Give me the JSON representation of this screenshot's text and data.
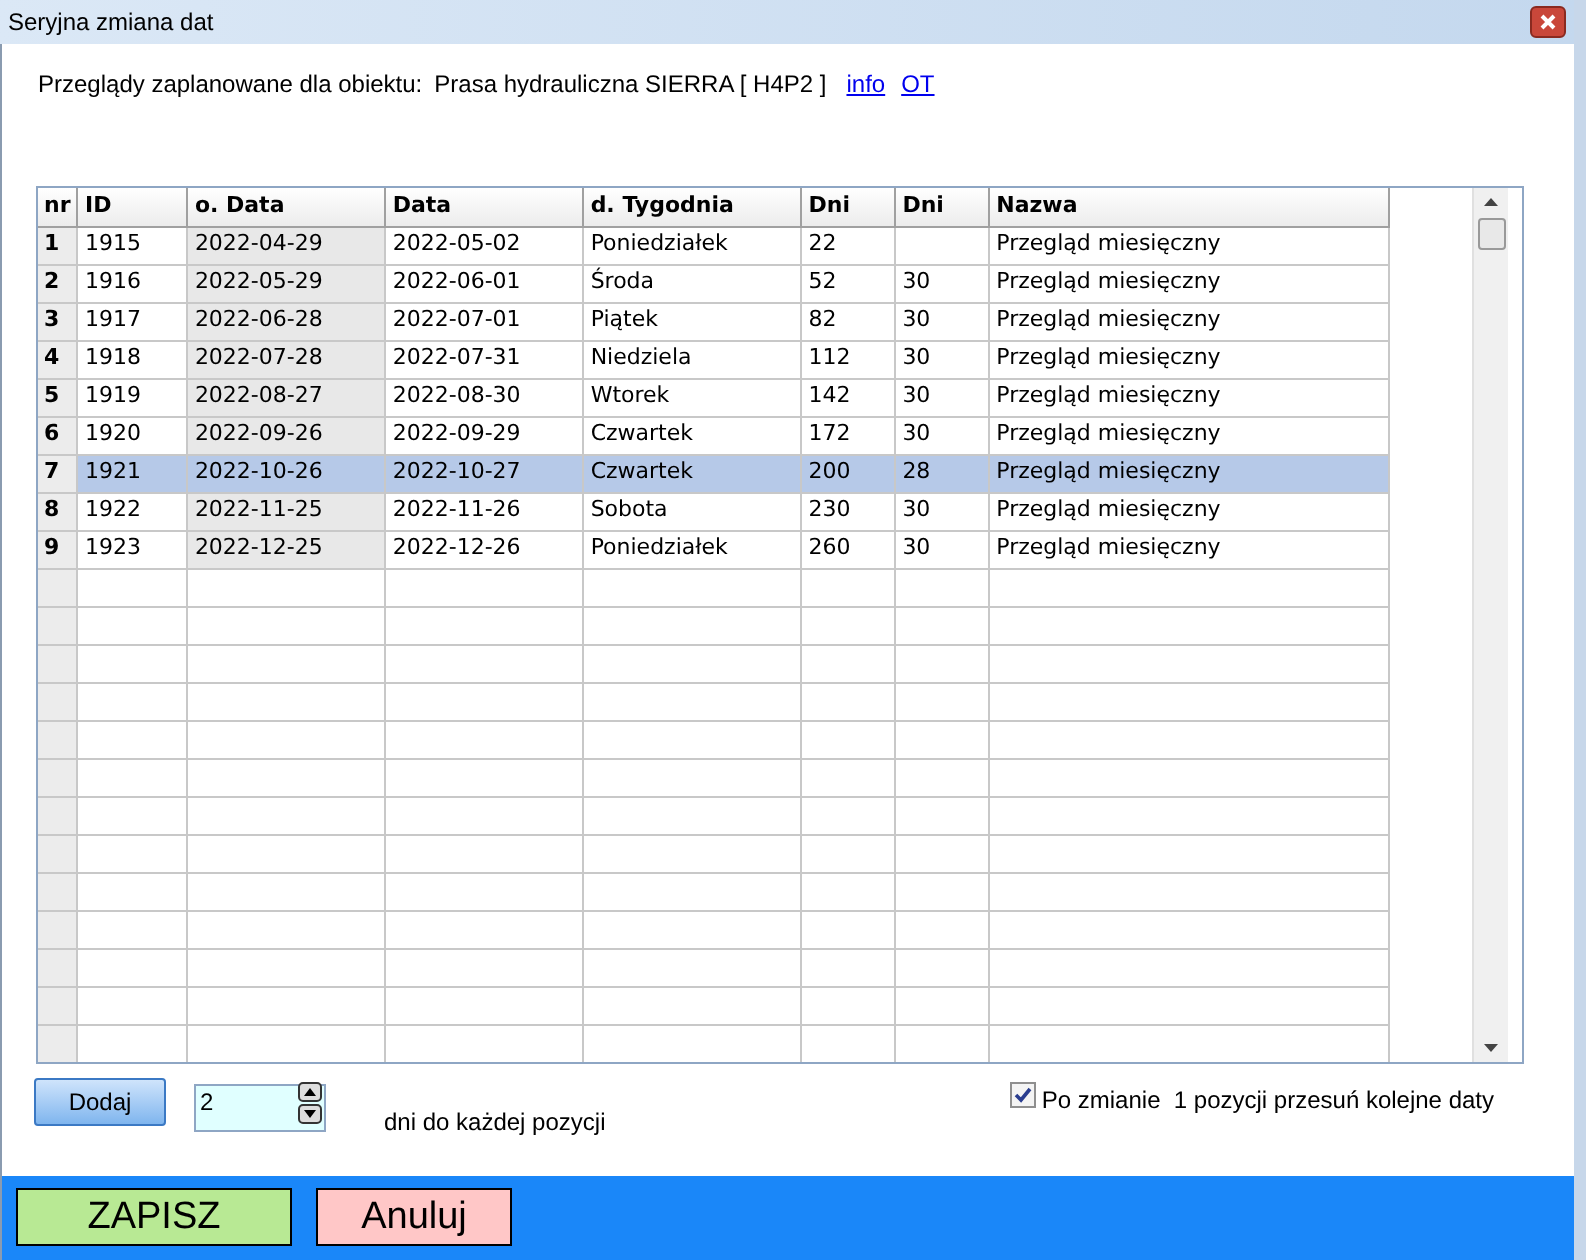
{
  "window": {
    "title": "Seryjna zmiana dat"
  },
  "header": {
    "label": "Przeglądy zaplanowane dla obiektu:",
    "object": "Prasa hydrauliczna SIERRA [ H4P2 ]",
    "links": [
      "info",
      "OT"
    ]
  },
  "table": {
    "columns": [
      "nr",
      "ID",
      "o. Data",
      "Data",
      "d. Tygodnia",
      "Dni",
      "Dni",
      "Nazwa"
    ],
    "rows": [
      {
        "cells": [
          "1",
          "1915",
          "2022-04-29",
          "2022-05-02",
          "Poniedziałek",
          "22",
          "",
          "Przegląd miesięczny"
        ],
        "selected": false
      },
      {
        "cells": [
          "2",
          "1916",
          "2022-05-29",
          "2022-06-01",
          "Środa",
          "52",
          "30",
          "Przegląd miesięczny"
        ],
        "selected": false
      },
      {
        "cells": [
          "3",
          "1917",
          "2022-06-28",
          "2022-07-01",
          "Piątek",
          "82",
          "30",
          "Przegląd miesięczny"
        ],
        "selected": false
      },
      {
        "cells": [
          "4",
          "1918",
          "2022-07-28",
          "2022-07-31",
          "Niedziela",
          "112",
          "30",
          "Przegląd miesięczny"
        ],
        "selected": false
      },
      {
        "cells": [
          "5",
          "1919",
          "2022-08-27",
          "2022-08-30",
          "Wtorek",
          "142",
          "30",
          "Przegląd miesięczny"
        ],
        "selected": false
      },
      {
        "cells": [
          "6",
          "1920",
          "2022-09-26",
          "2022-09-29",
          "Czwartek",
          "172",
          "30",
          "Przegląd miesięczny"
        ],
        "selected": false
      },
      {
        "cells": [
          "7",
          "1921",
          "2022-10-26",
          "2022-10-27",
          "Czwartek",
          "200",
          "28",
          "Przegląd miesięczny"
        ],
        "selected": true
      },
      {
        "cells": [
          "8",
          "1922",
          "2022-11-25",
          "2022-11-26",
          "Sobota",
          "230",
          "30",
          "Przegląd miesięczny"
        ],
        "selected": false
      },
      {
        "cells": [
          "9",
          "1923",
          "2022-12-25",
          "2022-12-26",
          "Poniedziałek",
          "260",
          "30",
          "Przegląd miesięczny"
        ],
        "selected": false
      }
    ]
  },
  "add_button": "Dodaj",
  "days_field": {
    "value": "2"
  },
  "days_label": "dni do każdej pozycji",
  "shift_option": {
    "label": "Po zmianie  1 pozycji przesuń kolejne daty",
    "checked": true
  },
  "buttons": [
    "ZAPISZ",
    "Anuluj"
  ]
}
